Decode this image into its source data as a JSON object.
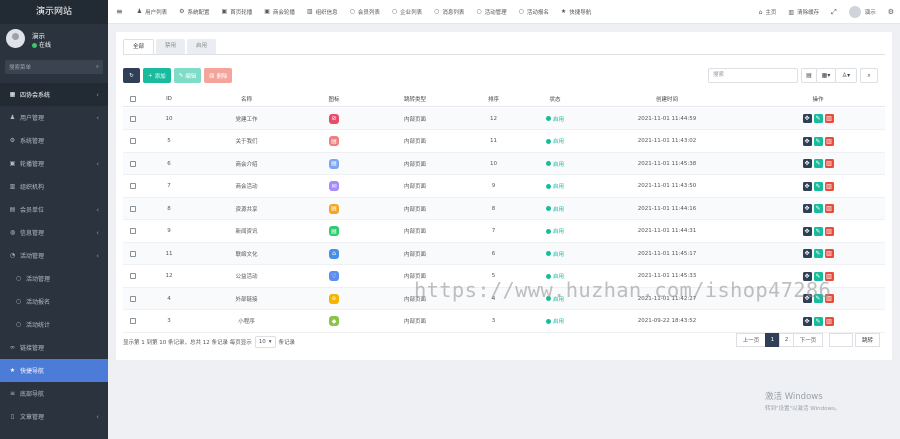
{
  "app": {
    "title": "演示网站"
  },
  "user": {
    "name": "演示",
    "status": "在线"
  },
  "sidebar": {
    "search_placeholder": "搜索菜单",
    "items": [
      {
        "label": "四协会系统",
        "icon": "grid-icon",
        "glyph": "▦",
        "type": "header",
        "has_arrow": true
      },
      {
        "label": "用户管理",
        "icon": "user-icon",
        "glyph": "♟",
        "type": "normal",
        "has_arrow": true
      },
      {
        "label": "系统管理",
        "icon": "cog-icon",
        "glyph": "⚙",
        "type": "normal",
        "has_arrow": false
      },
      {
        "label": "轮播管理",
        "icon": "image-icon",
        "glyph": "▣",
        "type": "normal",
        "has_arrow": true
      },
      {
        "label": "组织机构",
        "icon": "bank-icon",
        "glyph": "▥",
        "type": "normal",
        "has_arrow": false
      },
      {
        "label": "会员单位",
        "icon": "id-card-icon",
        "glyph": "▤",
        "type": "normal",
        "has_arrow": true
      },
      {
        "label": "信息管理",
        "icon": "globe-icon",
        "glyph": "◍",
        "type": "normal",
        "has_arrow": true
      },
      {
        "label": "活动管理",
        "icon": "chart-icon",
        "glyph": "◔",
        "type": "normal",
        "has_arrow": true
      },
      {
        "label": "活动管理",
        "icon": "circle-icon",
        "glyph": "○",
        "type": "sub",
        "has_arrow": false
      },
      {
        "label": "活动报名",
        "icon": "circle-icon",
        "glyph": "○",
        "type": "sub",
        "has_arrow": false
      },
      {
        "label": "活动统计",
        "icon": "circle-icon",
        "glyph": "○",
        "type": "sub",
        "has_arrow": false
      },
      {
        "label": "链接管理",
        "icon": "link-icon",
        "glyph": "∞",
        "type": "normal",
        "has_arrow": false
      },
      {
        "label": "快捷导航",
        "icon": "star-icon",
        "glyph": "★",
        "type": "active",
        "has_arrow": false
      },
      {
        "label": "底部导航",
        "icon": "list-icon",
        "glyph": "≡",
        "type": "normal",
        "has_arrow": false
      },
      {
        "label": "文章管理",
        "icon": "file-icon",
        "glyph": "▯",
        "type": "normal",
        "has_arrow": true
      }
    ]
  },
  "topbar": {
    "tabs": [
      {
        "label": "用户列表",
        "icon": "user-icon",
        "glyph": "♟"
      },
      {
        "label": "系统配置",
        "icon": "cog-icon",
        "glyph": "⚙"
      },
      {
        "label": "首页轮播",
        "icon": "image-icon",
        "glyph": "▣"
      },
      {
        "label": "商会轮播",
        "icon": "image-icon",
        "glyph": "▣"
      },
      {
        "label": "组织信息",
        "icon": "bank-icon",
        "glyph": "▥"
      },
      {
        "label": "会员列表",
        "icon": "circle-icon",
        "glyph": "○"
      },
      {
        "label": "企业列表",
        "icon": "circle-icon",
        "glyph": "○"
      },
      {
        "label": "消息列表",
        "icon": "circle-icon",
        "glyph": "○"
      },
      {
        "label": "活动管理",
        "icon": "circle-icon",
        "glyph": "○"
      },
      {
        "label": "活动报名",
        "icon": "circle-icon",
        "glyph": "○"
      },
      {
        "label": "快捷导航",
        "icon": "star-icon",
        "glyph": "★"
      }
    ],
    "home": "主页",
    "clear_cache": "清除缓存",
    "user": "演示"
  },
  "content": {
    "tabs": [
      "全部",
      "禁用",
      "启用"
    ],
    "toolbar": {
      "add": "添加",
      "edit": "编辑",
      "delete": "删除"
    },
    "search_placeholder": "搜索",
    "columns": {
      "id": "ID",
      "name": "名称",
      "icon": "图标",
      "type": "跳转类型",
      "order": "排序",
      "status": "状态",
      "time": "创建时间",
      "ops": "操作"
    },
    "rows": [
      {
        "id": "10",
        "name": "党建工作",
        "type": "内部页面",
        "order": "12",
        "status": "启用",
        "time": "2021-11-01 11:44:59",
        "color": "#e74c6a",
        "glyph": "⊘"
      },
      {
        "id": "5",
        "name": "关于我们",
        "type": "内部页面",
        "order": "11",
        "status": "启用",
        "time": "2021-11-01 11:43:02",
        "color": "#f08080",
        "glyph": "▤"
      },
      {
        "id": "6",
        "name": "商会介绍",
        "type": "内部页面",
        "order": "10",
        "status": "启用",
        "time": "2021-11-01 11:45:38",
        "color": "#7ea6f0",
        "glyph": "▤"
      },
      {
        "id": "7",
        "name": "商会活动",
        "type": "内部页面",
        "order": "9",
        "status": "启用",
        "time": "2021-11-01 11:43:50",
        "color": "#a78bfa",
        "glyph": "✉"
      },
      {
        "id": "8",
        "name": "资源共享",
        "type": "内部页面",
        "order": "8",
        "status": "启用",
        "time": "2021-11-01 11:44:16",
        "color": "#f5a623",
        "glyph": "▤"
      },
      {
        "id": "9",
        "name": "新闻资讯",
        "type": "内部页面",
        "order": "7",
        "status": "启用",
        "time": "2021-11-01 11:44:31",
        "color": "#2ecc71",
        "glyph": "▤"
      },
      {
        "id": "11",
        "name": "联络文化",
        "type": "内部页面",
        "order": "6",
        "status": "启用",
        "time": "2021-11-01 11:45:17",
        "color": "#4a90e2",
        "glyph": "⌂"
      },
      {
        "id": "12",
        "name": "公益活动",
        "type": "内部页面",
        "order": "5",
        "status": "启用",
        "time": "2021-11-01 11:45:33",
        "color": "#5b8def",
        "glyph": "♡"
      },
      {
        "id": "4",
        "name": "外部链接",
        "type": "内部页面",
        "order": "4",
        "status": "启用",
        "time": "2021-11-01 11:42:27",
        "color": "#f7b500",
        "glyph": "e"
      },
      {
        "id": "3",
        "name": "小程序",
        "type": "内部页面",
        "order": "3",
        "status": "启用",
        "time": "2021-09-22 18:43:52",
        "color": "#8bc34a",
        "glyph": "◆"
      }
    ],
    "footer": {
      "info_prefix": "显示第 1 到第 10 条记录，总共 12 条记录 每页显示",
      "page_size": "10",
      "info_suffix": "条记录"
    },
    "pager": {
      "prev": "上一页",
      "pages": [
        "1",
        "2"
      ],
      "current": "1",
      "next": "下一页",
      "jump": "跳转"
    }
  },
  "watermark": "https://www.huzhan.com/ishop47286",
  "windows": {
    "title": "激活 Windows",
    "sub": "转到\"设置\"以激活 Windows。"
  }
}
